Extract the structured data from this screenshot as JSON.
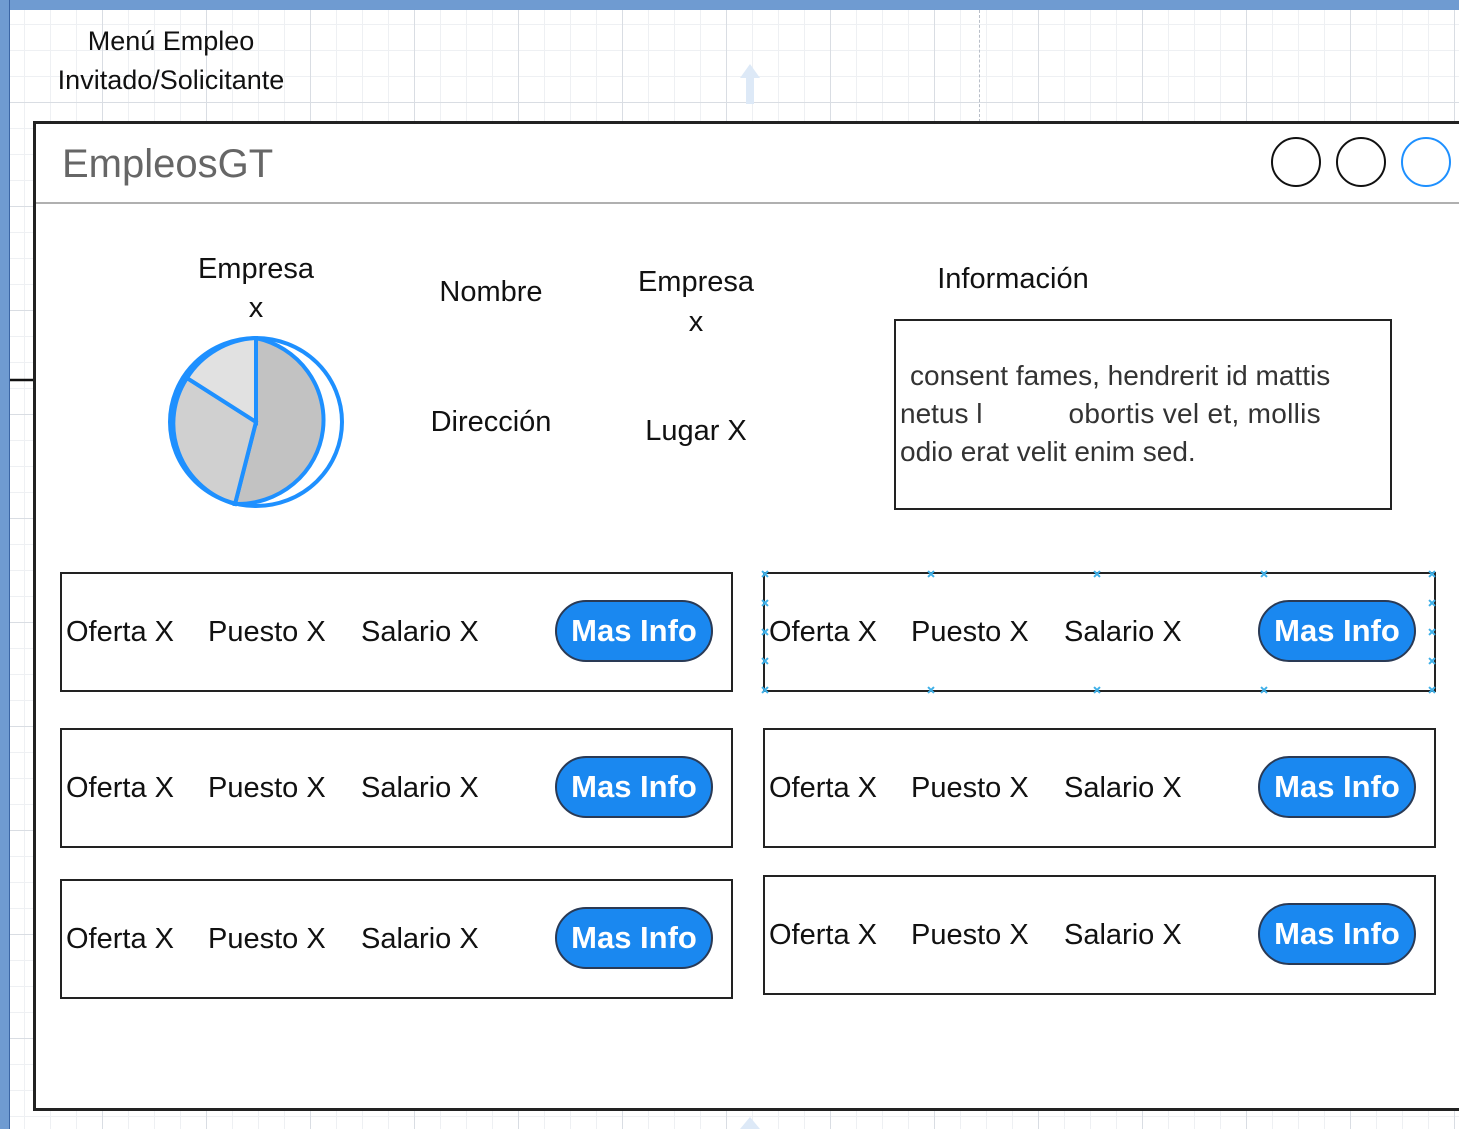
{
  "diagram_caption": [
    "Menú Empleo",
    "Invitado/Solicitante"
  ],
  "window": {
    "title": "EmpleosGT"
  },
  "company": {
    "pie_label": [
      "Empresa",
      "x"
    ],
    "name_label": "Nombre",
    "name_value": [
      "Empresa",
      "x"
    ],
    "address_label": "Dirección",
    "address_value": "Lugar X"
  },
  "info": {
    "heading": "Información",
    "lines": [
      "consent fames, hendrerit id mattis",
      "netus l",
      "obortis  vel et, mollis",
      "odio erat velit enim sed."
    ]
  },
  "offers": [
    {
      "offer": "Oferta X",
      "position": "Puesto X",
      "salary": "Salario X",
      "button": "Mas Info"
    },
    {
      "offer": "Oferta X",
      "position": "Puesto X",
      "salary": "Salario X",
      "button": "Mas Info"
    },
    {
      "offer": "Oferta X",
      "position": "Puesto X",
      "salary": "Salario X",
      "button": "Mas Info"
    },
    {
      "offer": "Oferta X",
      "position": "Puesto X",
      "salary": "Salario X",
      "button": "Mas Info"
    },
    {
      "offer": "Oferta X",
      "position": "Puesto X",
      "salary": "Salario X",
      "button": "Mas Info"
    },
    {
      "offer": "Oferta X",
      "position": "Puesto X",
      "salary": "Salario X",
      "button": "Mas Info"
    }
  ],
  "colors": {
    "accent": "#1a88f0",
    "canvas_frame": "#6f9bd1",
    "pie_stroke": "#1e90ff",
    "selection": "#3fb0e8"
  },
  "icons": {
    "window_buttons": [
      "circle-icon",
      "circle-icon",
      "circle-icon"
    ],
    "connector": "arrow-right-icon"
  }
}
